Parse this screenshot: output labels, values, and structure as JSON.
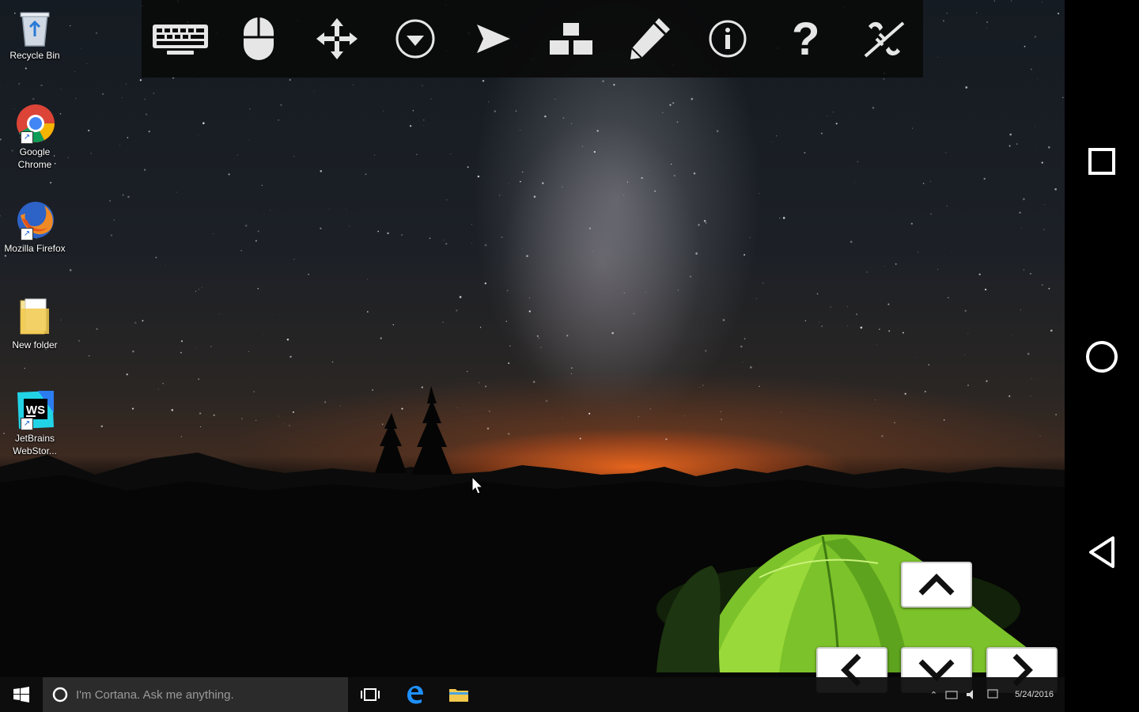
{
  "desktop_icons": [
    {
      "name": "recycle-bin",
      "label": "Recycle Bin"
    },
    {
      "name": "google-chrome",
      "label": "Google Chrome"
    },
    {
      "name": "mozilla-firefox",
      "label": "Mozilla Firefox"
    },
    {
      "name": "new-folder",
      "label": "New folder"
    },
    {
      "name": "jetbrains-webstorm",
      "label": "JetBrains WebStor...",
      "logo_text": "WS"
    }
  ],
  "toolbar": {
    "icons": [
      "keyboard-icon",
      "mouse-icon",
      "move-icon",
      "dropdown-circle-icon",
      "send-icon",
      "hierarchy-icon",
      "pencil-icon",
      "info-icon",
      "help-icon",
      "disconnect-icon"
    ],
    "help_glyph": "?"
  },
  "arrow_keys": [
    "up",
    "left",
    "down",
    "right"
  ],
  "taskbar": {
    "search_placeholder": "I'm Cortana. Ask me anything.",
    "tray_date": "5/24/2016"
  },
  "android_nav": [
    "recent-apps",
    "home",
    "back"
  ],
  "colors": {
    "toolbar_bg": "#0a0a0a",
    "taskbar_bg": "#0e0e0e",
    "edge_blue": "#1e90ff",
    "folder_yellow": "#f2c94c"
  }
}
